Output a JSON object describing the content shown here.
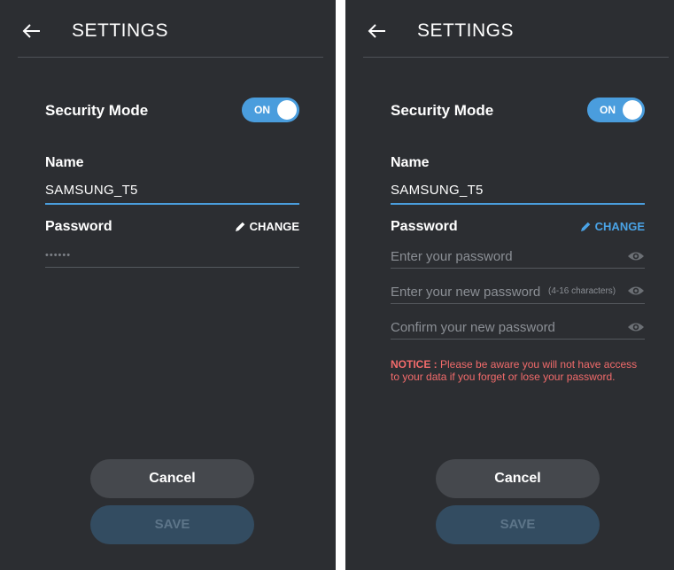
{
  "left": {
    "header": {
      "title": "SETTINGS"
    },
    "security_mode": {
      "label": "Security Mode",
      "toggle": "ON"
    },
    "name": {
      "label": "Name",
      "value": "SAMSUNG_T5"
    },
    "password": {
      "label": "Password",
      "change_label": "CHANGE",
      "masked_value": "••••••"
    },
    "buttons": {
      "cancel": "Cancel",
      "save": "SAVE"
    }
  },
  "right": {
    "header": {
      "title": "SETTINGS"
    },
    "security_mode": {
      "label": "Security Mode",
      "toggle": "ON"
    },
    "name": {
      "label": "Name",
      "value": "SAMSUNG_T5"
    },
    "password": {
      "label": "Password",
      "change_label": "CHANGE",
      "current_placeholder": "Enter your password",
      "new_placeholder": "Enter your new password",
      "new_hint": "(4-16 characters)",
      "confirm_placeholder": "Confirm your new password"
    },
    "notice": {
      "prefix": "NOTICE :",
      "text": " Please be aware you will not have access to your data if you forget or lose your password."
    },
    "buttons": {
      "cancel": "Cancel",
      "save": "SAVE"
    }
  },
  "colors": {
    "panel_bg": "#2c2e32",
    "accent": "#4a9ddd",
    "notice": "#f26b6b",
    "save_bg": "#334c61"
  },
  "icons": [
    "back-arrow-icon",
    "pencil-icon",
    "eye-icon"
  ]
}
